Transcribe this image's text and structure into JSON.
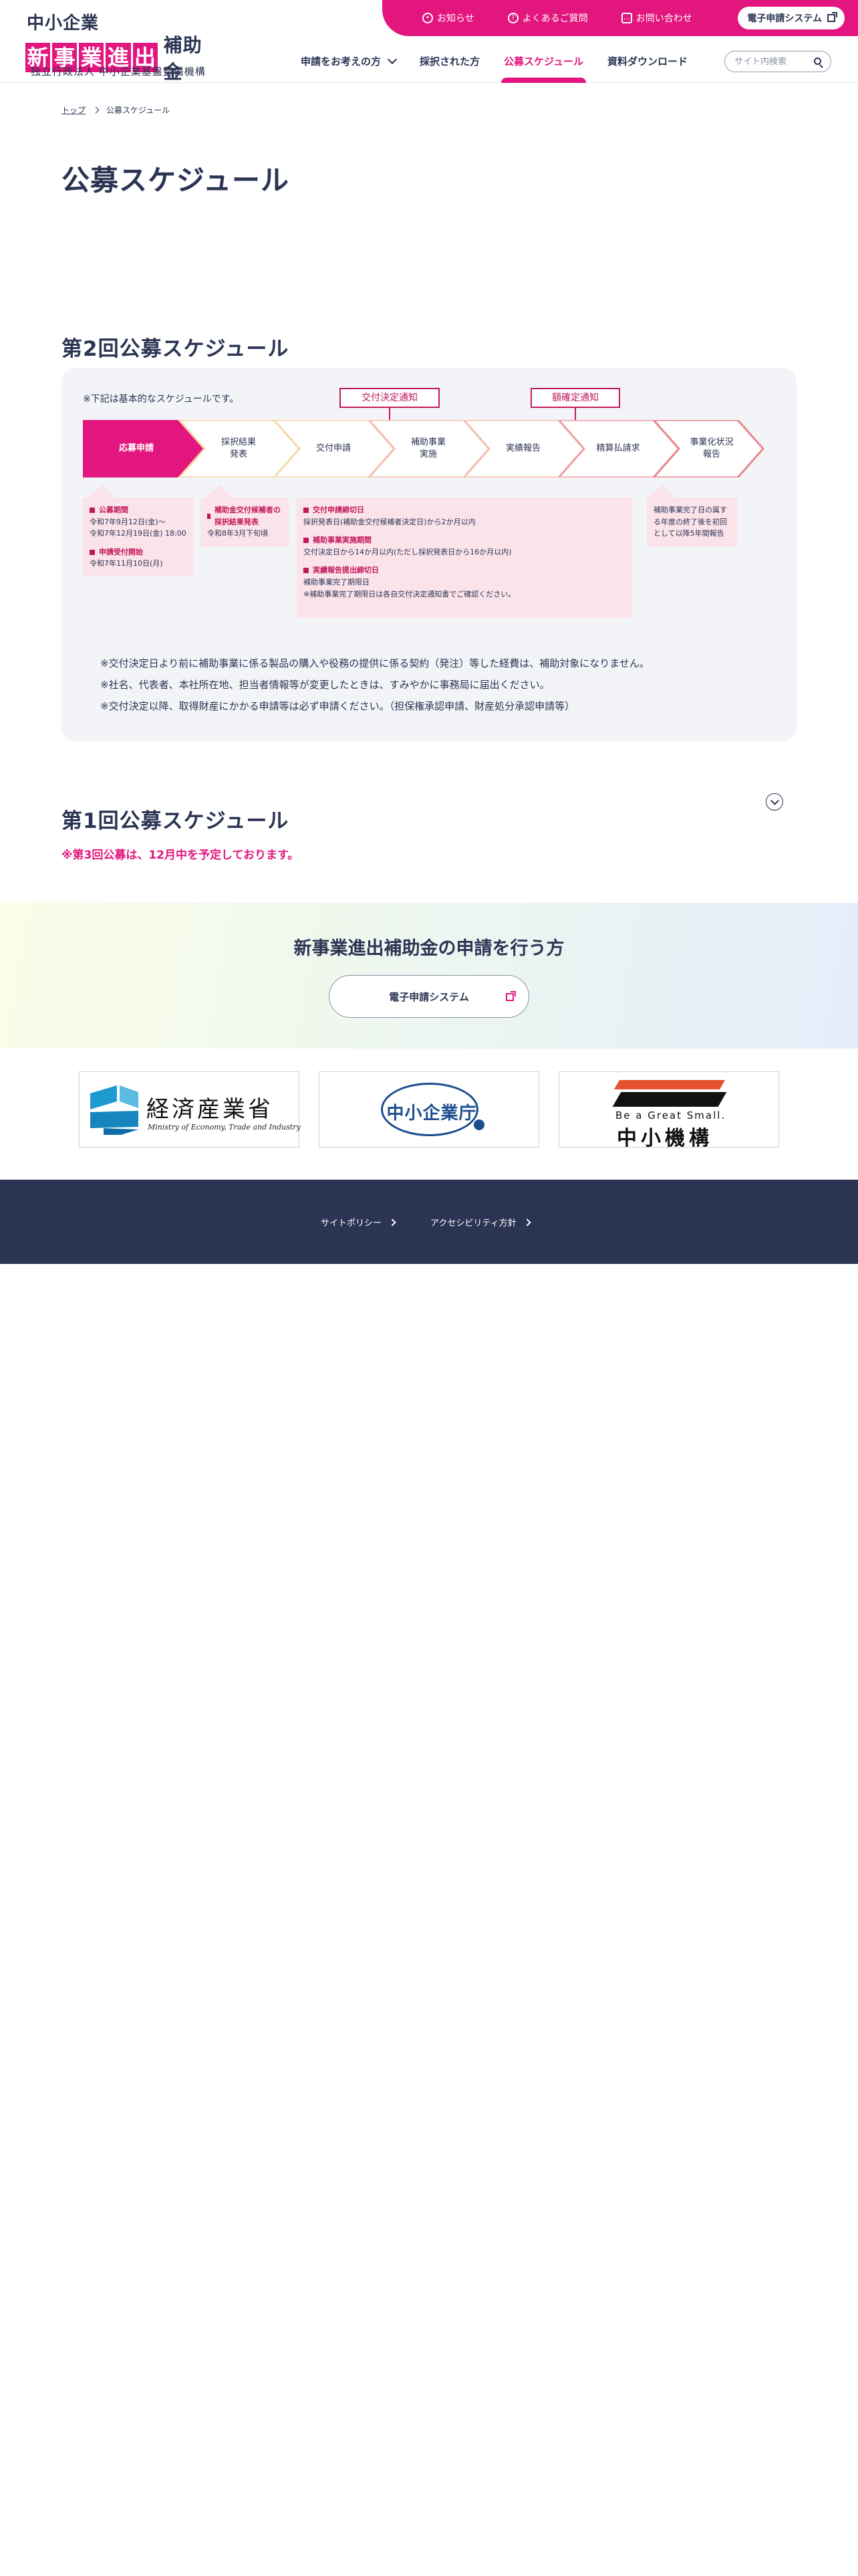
{
  "header": {
    "logo": {
      "line1": "中小企業",
      "boxed_chars": [
        "新",
        "事",
        "業",
        "進",
        "出"
      ],
      "suffix": "補助金",
      "line3": "独立行政法人 中小企業基盤整備機構"
    },
    "util_links": [
      {
        "label": "お知らせ",
        "icon": "bell-icon"
      },
      {
        "label": "よくあるご質問",
        "icon": "question-icon"
      },
      {
        "label": "お問い合わせ",
        "icon": "chat-icon"
      }
    ],
    "util_cta": "電子申請システム",
    "nav": [
      {
        "label": "申請をお考えの方",
        "has_dropdown": true
      },
      {
        "label": "採択された方"
      },
      {
        "label": "公募スケジュール",
        "active": true
      },
      {
        "label": "資料ダウンロード"
      }
    ],
    "search_placeholder": "サイト内検索"
  },
  "breadcrumb": {
    "home": "トップ",
    "current": "公募スケジュール"
  },
  "page_title": "公募スケジュール",
  "round2": {
    "title": "第2回公募スケジュール",
    "note": "※下記は基本的なスケジュールです。",
    "flags": [
      "交付決定通知",
      "額確定通知"
    ],
    "steps": [
      "応募申請",
      "採択結果\n発表",
      "交付申請",
      "補助事業\n実施",
      "実績報告",
      "精算払請求",
      "事業化状況\n報告"
    ],
    "details": {
      "apply": {
        "h1": "公募期間",
        "t1": "令和7年9月12日(金)～\n令和7年12月19日(金) 18:00",
        "h2": "申請受付開始",
        "t2": "令和7年11月10日(月)"
      },
      "result": {
        "h1": "補助金交付候補者の採択結果発表",
        "t1": "令和8年3月下旬頃"
      },
      "main": {
        "h1": "交付申請締切日",
        "t1": "採択発表日(補助金交付候補者決定日)から2か月以内",
        "h2": "補助事業実施期間",
        "t2": "交付決定日から14か月以内(ただし採択発表日から16か月以内)",
        "h3": "実績報告提出締切日",
        "t3": "補助事業完了期限日\n※補助事業完了期限日は各自交付決定通知書でご確認ください。"
      },
      "report": {
        "t1": "補助事業完了日の属する年度の終了後を初回として以降5年間報告"
      }
    },
    "notes": [
      "※交付決定日より前に補助事業に係る製品の購入や役務の提供に係る契約（発注）等した経費は、補助対象になりません。",
      "※社名、代表者、本社所在地、担当者情報等が変更したときは、すみやかに事務局に届出ください。",
      "※交付決定以降、取得財産にかかる申請等は必ず申請ください。（担保権承認申請、財産処分承認申請等）"
    ]
  },
  "round1": {
    "title": "第1回公募スケジュール",
    "note": "※第3回公募は、12月中を予定しております。"
  },
  "cta": {
    "title": "新事業進出補助金の申請を行う方",
    "button": "電子申請システム"
  },
  "banners": {
    "meti": {
      "name": "経済産業省",
      "english": "Ministry of Economy, Trade and Industry"
    },
    "chusho": {
      "name": "中小企業庁"
    },
    "smrj": {
      "tagline": "Be a Great Small.",
      "name": "中小機構"
    }
  },
  "footer": {
    "links": [
      "サイトポリシー",
      "アクセシビリティ方針"
    ]
  },
  "colors": {
    "accent": "#e2167e",
    "navy": "#2b3453",
    "pink_light": "#fbe3ea",
    "flag": "#c2185b"
  }
}
